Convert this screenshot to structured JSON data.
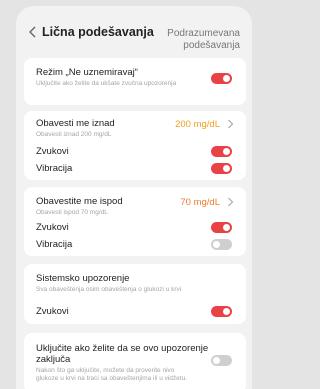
{
  "header": {
    "title": "Lična podešavanja",
    "defaults_line1": "Podrazumevana",
    "defaults_line2": "podešavanja"
  },
  "dnd": {
    "title": "Režim „Ne uznemiravaj“",
    "subtitle": "Uključite ako želite da ukšate zvučna upozorenja",
    "enabled": true
  },
  "high_alert": {
    "title": "Obavesti me iznad",
    "subtitle": "Obavesti iznad 200 mg/dL",
    "value": "200 mg/dL",
    "sounds_label": "Zvukovi",
    "sounds_on": true,
    "vibration_label": "Vibracija",
    "vibration_on": true
  },
  "low_alert": {
    "title": "Obavestite me ispod",
    "subtitle": "Obavesti ispod 70 mg/dL",
    "value": "70 mg/dL",
    "sounds_label": "Zvukovi",
    "sounds_on": true,
    "vibration_label": "Vibracija",
    "vibration_on": false
  },
  "system_alert": {
    "title": "Sistemsko upozorenje",
    "subtitle": "Sva obaveštenja osim obaveštenja o glukozi u krvi",
    "sounds_label": "Zvukovi",
    "sounds_on": true
  },
  "lock_alert": {
    "title": "Uključite ako želite da se ovo upozorenje zaključa",
    "subtitle_line1": "Nakon što ga uključite, možete da proverite nivo",
    "subtitle_line2": "glukoze u krvi na traci sa obaveštenjima ili u vidžetu.",
    "enabled": false
  },
  "colors": {
    "accent_value": "#f0a020",
    "toggle_on": "#e94246",
    "toggle_off": "#cfcfcf"
  }
}
